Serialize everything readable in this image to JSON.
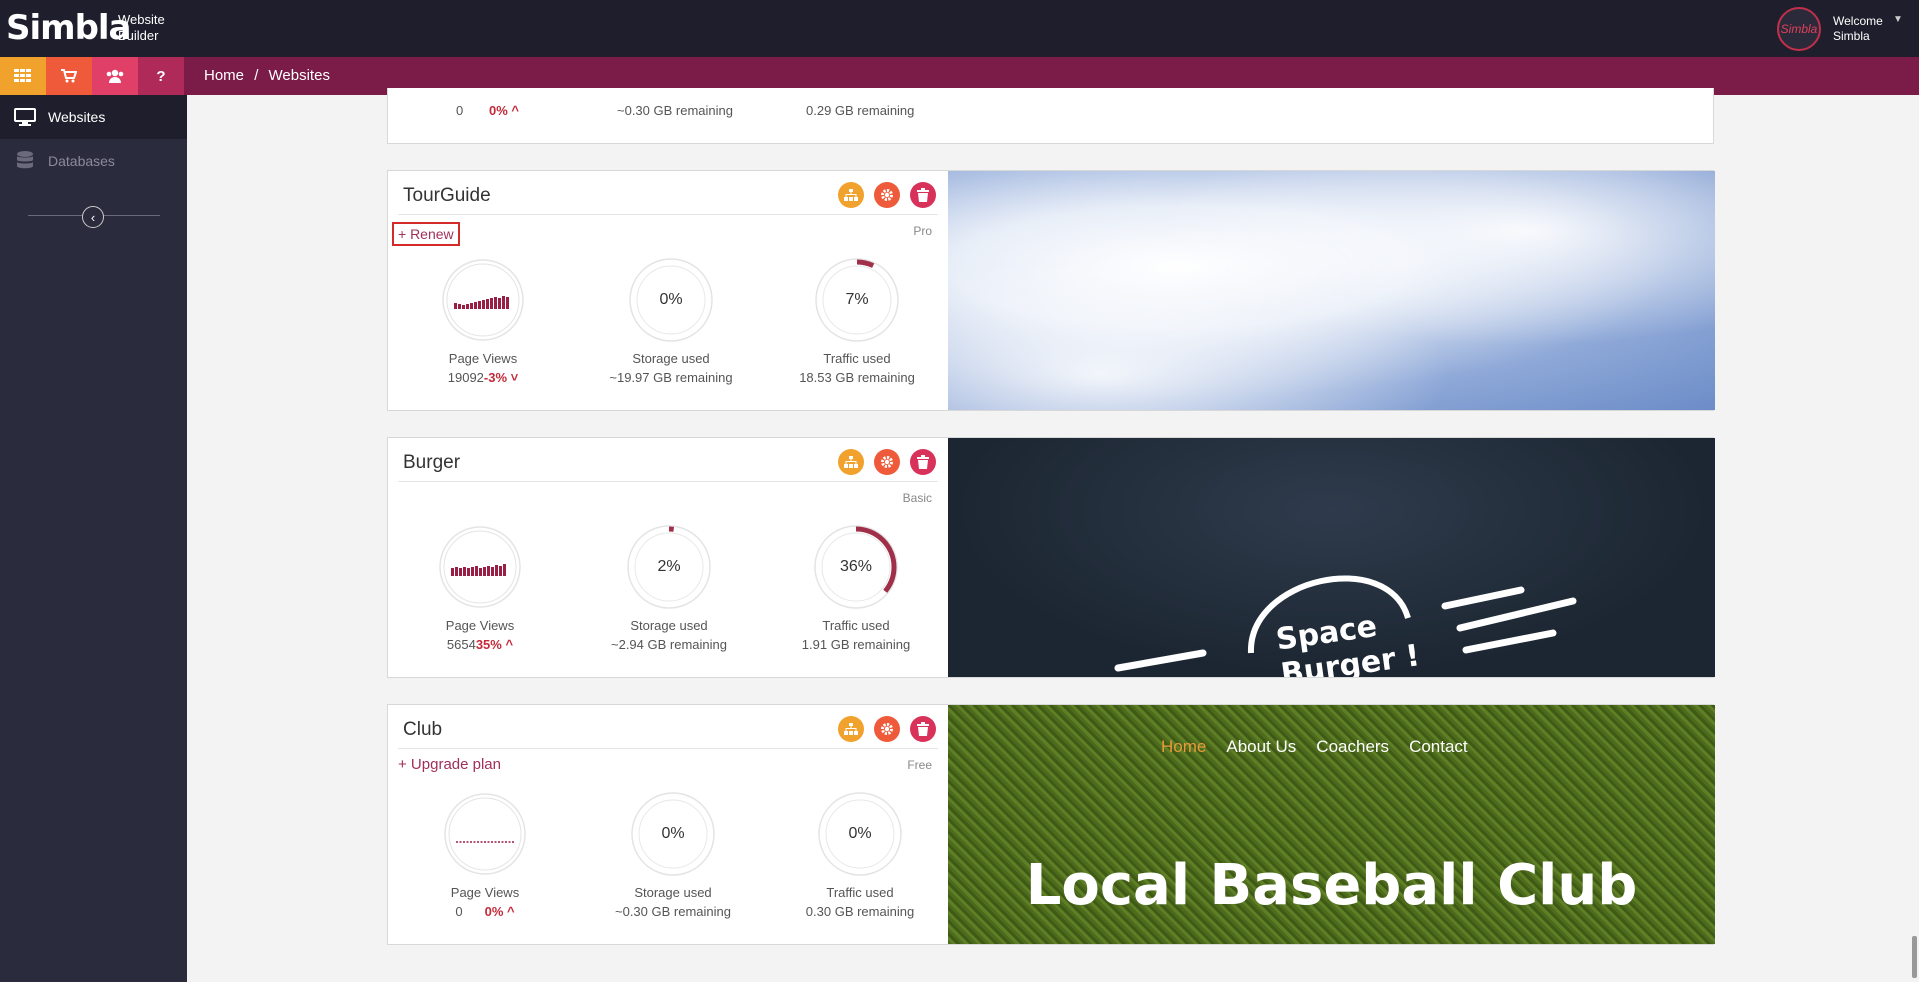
{
  "header": {
    "logo": "Simbla",
    "logo_sub_1": "Website",
    "logo_sub_2": "Builder",
    "avatar_text": "Simbla",
    "welcome_1": "Welcome",
    "welcome_2": "Simbla"
  },
  "breadcrumb": {
    "home": "Home",
    "sep": "/",
    "current": "Websites"
  },
  "sidebar": {
    "items": [
      {
        "label": "Websites"
      },
      {
        "label": "Databases"
      }
    ]
  },
  "top_partial": {
    "pv_count": "0",
    "pv_change": "0%",
    "storage_sub": "~0.30 GB remaining",
    "traffic_sub": "0.29 GB remaining"
  },
  "sites": [
    {
      "name": "TourGuide",
      "action": "+ Renew",
      "plan": "Pro",
      "pv_label": "Page Views",
      "pv_count": "19092",
      "pv_change": "-3%",
      "storage_pct": "0%",
      "storage_fill": 0,
      "storage_label": "Storage used",
      "storage_sub": "~19.97 GB remaining",
      "traffic_pct": "7%",
      "traffic_fill": 0.07,
      "traffic_label": "Traffic used",
      "traffic_sub": "18.53 GB remaining"
    },
    {
      "name": "Burger",
      "action": "",
      "plan": "Basic",
      "pv_label": "Page Views",
      "pv_count": "5654",
      "pv_change": "35%",
      "storage_pct": "2%",
      "storage_fill": 0.02,
      "storage_label": "Storage used",
      "storage_sub": "~2.94 GB remaining",
      "traffic_pct": "36%",
      "traffic_fill": 0.36,
      "traffic_label": "Traffic used",
      "traffic_sub": "1.91 GB remaining",
      "image_text_1": "Space",
      "image_text_2": "Burger !"
    },
    {
      "name": "Club",
      "action": "+ Upgrade plan",
      "plan": "Free",
      "pv_label": "Page Views",
      "pv_count": "0",
      "pv_change": "0%",
      "storage_pct": "0%",
      "storage_fill": 0,
      "storage_label": "Storage used",
      "storage_sub": "~0.30 GB remaining",
      "traffic_pct": "0%",
      "traffic_fill": 0,
      "traffic_label": "Traffic used",
      "traffic_sub": "0.30 GB remaining",
      "nav": [
        "Home",
        "About Us",
        "Coachers",
        "Contact"
      ],
      "image_title": "Local Baseball Club"
    }
  ],
  "colors": {
    "accent": "#7a1b48",
    "topbar": "#1e1e2c",
    "sidebar": "#2b2b3e",
    "ring": "#a0304a"
  }
}
